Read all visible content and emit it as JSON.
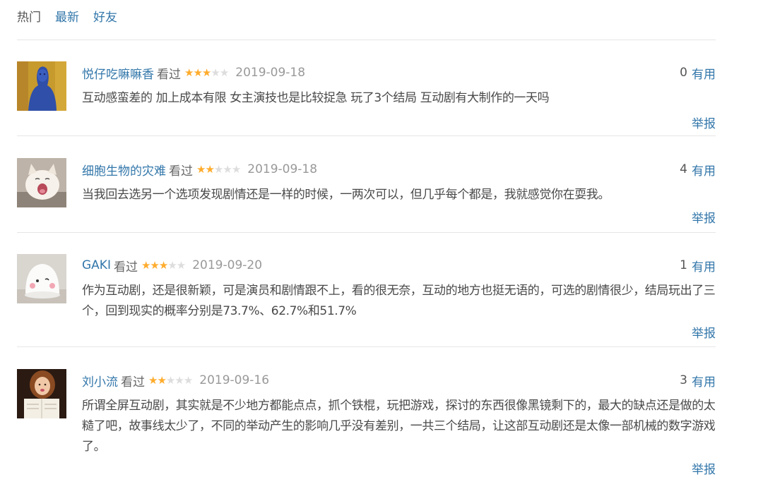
{
  "tabs": [
    {
      "label": "热门"
    },
    {
      "label": "最新"
    },
    {
      "label": "好友"
    }
  ],
  "colors": {
    "link": "#3377aa",
    "star_on": "#ffac2d",
    "star_off": "#dddddd",
    "date": "#999999",
    "divider": "#e6e6e6"
  },
  "comments": [
    {
      "user": "悦仔吃嘛嘛香",
      "status": "看过",
      "rating": 3,
      "rating_max": 5,
      "date": "2019-09-18",
      "votes": "0",
      "vote_label": "有用",
      "text": "互动感蛮差的 加上成本有限 女主演技也是比较捉急 玩了3个结局 互动剧有大制作的一天吗",
      "report_label": "举报",
      "avatar_icon": "blue-painted-figure-avatar"
    },
    {
      "user": "细胞生物的灾难",
      "status": "看过",
      "rating": 2,
      "rating_max": 5,
      "date": "2019-09-18",
      "votes": "4",
      "vote_label": "有用",
      "text": "当我回去选另一个选项发现剧情还是一样的时候，一两次可以，但几乎每个都是，我就感觉你在耍我。",
      "report_label": "举报",
      "avatar_icon": "yawning-cat-avatar"
    },
    {
      "user": "GAKI",
      "status": "看过",
      "rating": 3,
      "rating_max": 5,
      "date": "2019-09-20",
      "votes": "1",
      "vote_label": "有用",
      "text": "作为互动剧，还是很新颖，可是演员和剧情跟不上，看的很无奈，互动的地方也挺无语的，可选的剧情很少，结局玩出了三个，回到现实的概率分别是73.7%、62.7%和51.7%",
      "report_label": "举报",
      "avatar_icon": "white-blob-face-avatar"
    },
    {
      "user": "刘小流",
      "status": "看过",
      "rating": 2,
      "rating_max": 5,
      "date": "2019-09-16",
      "votes": "3",
      "vote_label": "有用",
      "text": "所谓全屏互动剧，其实就是不少地方都能点点，抓个铁棍，玩把游戏，探讨的东西很像黑镜剩下的，最大的缺点还是做的太糙了吧，故事线太少了，不同的举动产生的影响几乎没有差别，一共三个结局，让这部互动剧还是太像一部机械的数字游戏了。",
      "report_label": "举报",
      "avatar_icon": "reading-girl-avatar"
    }
  ]
}
